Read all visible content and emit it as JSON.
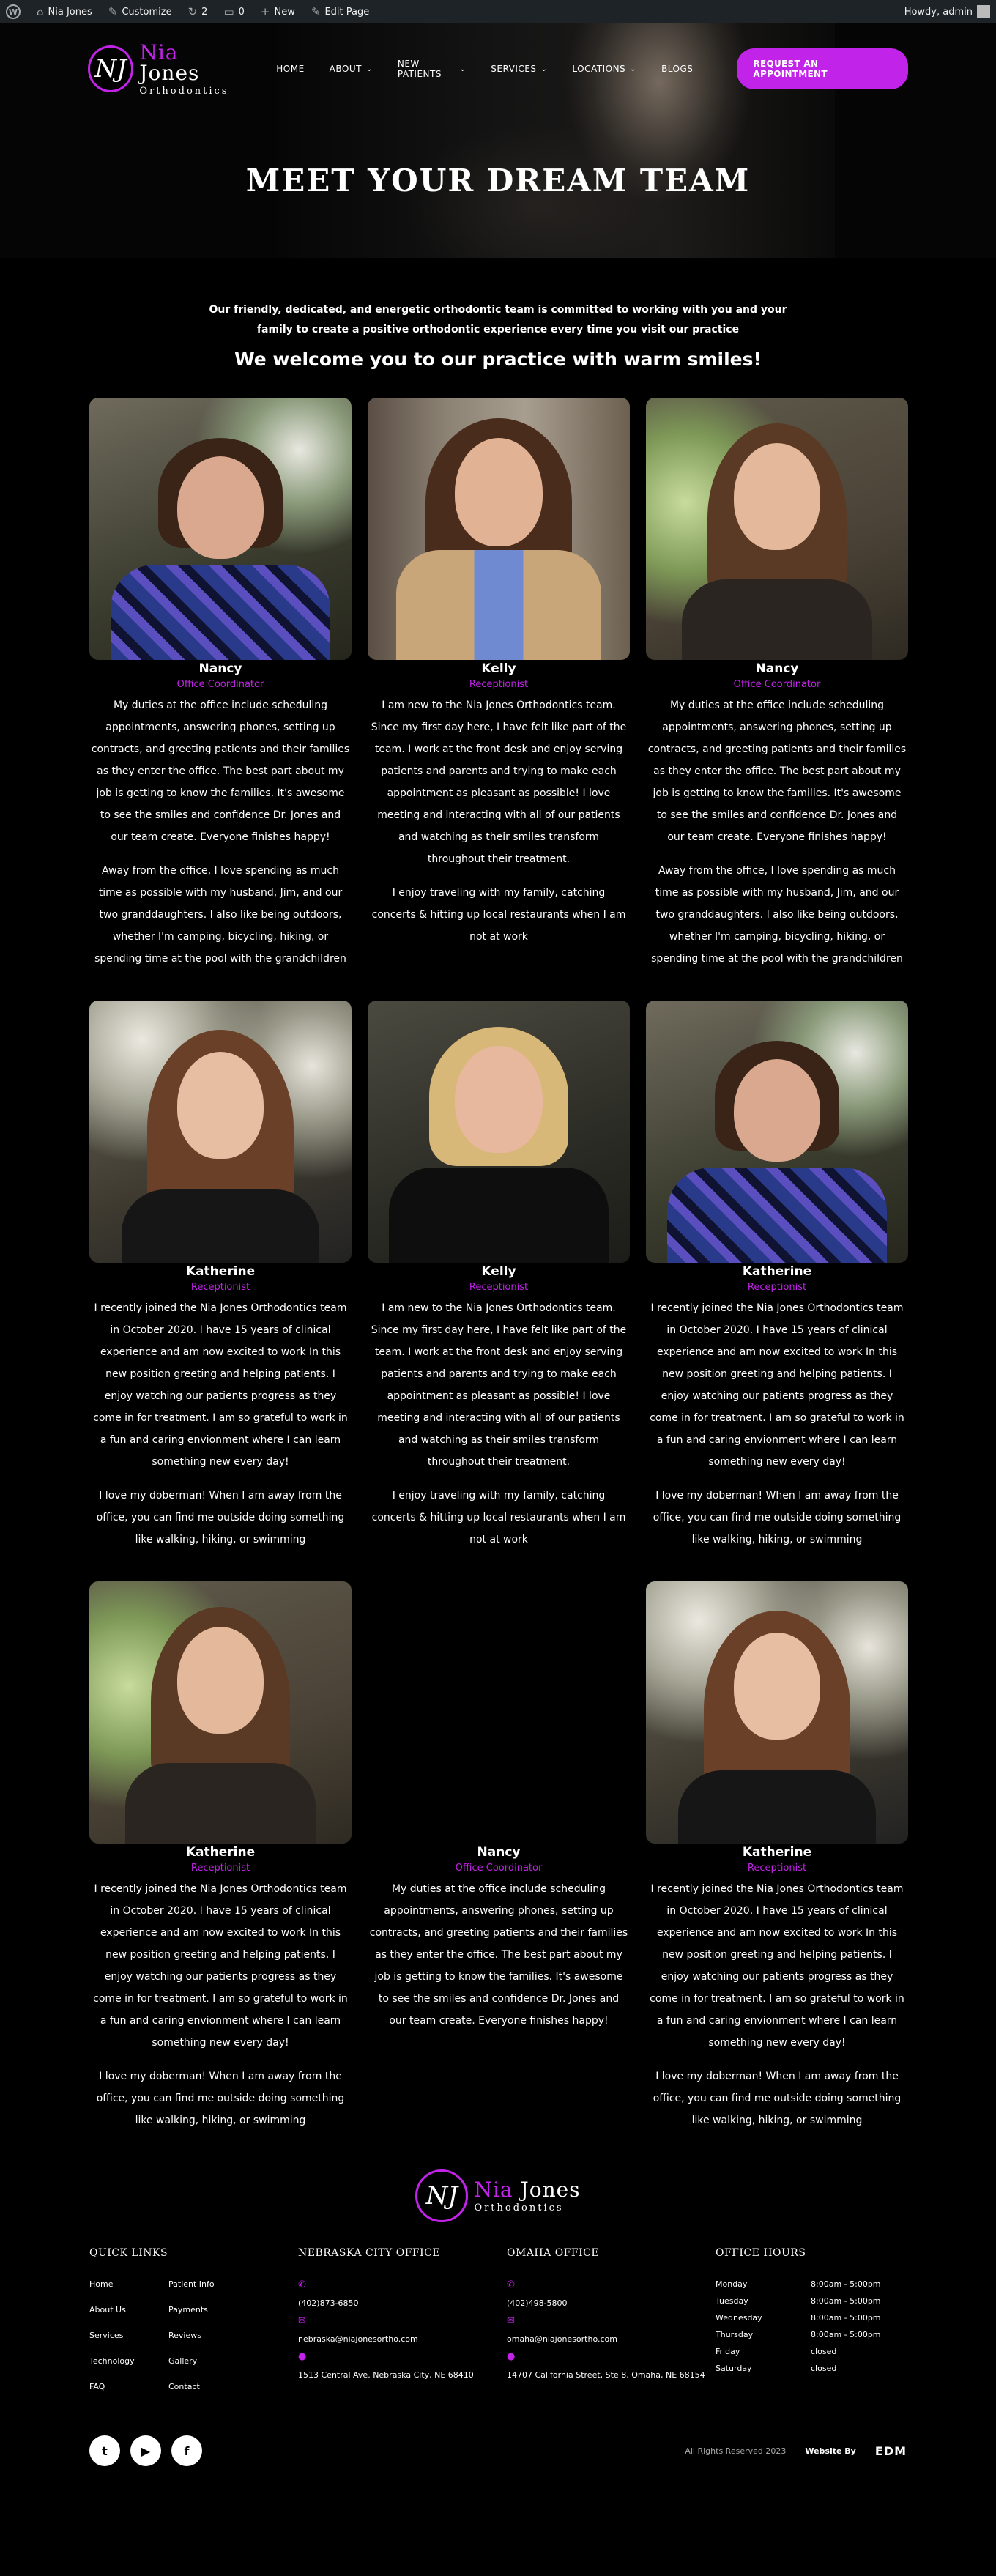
{
  "admin_bar": {
    "site": "Nia Jones",
    "customize": "Customize",
    "updates": "2",
    "comments": "0",
    "new": "New",
    "edit": "Edit Page",
    "howdy": "Howdy, admin"
  },
  "brand": {
    "first": "Nia",
    "last": "Jones",
    "sub": "Orthodontics",
    "mark": "NJ",
    "accent": "#c223e8"
  },
  "nav": {
    "items": [
      "HOME",
      "ABOUT",
      "NEW PATIENTS",
      "SERVICES",
      "LOCATIONS",
      "BLOGS"
    ],
    "cta": "REQUEST AN APPOINTMENT"
  },
  "hero": {
    "title": "MEET YOUR DREAM TEAM"
  },
  "intro": {
    "text": "Our friendly, dedicated, and energetic orthodontic team is committed to working with you and your family to create a positive orthodontic experience every time you visit our practice",
    "welcome": "We welcome you to our practice with warm smiles!"
  },
  "team": [
    {
      "name": "Nancy",
      "role": "Office Coordinator",
      "bio1": "My duties at the office include scheduling appointments, answering phones, setting up contracts, and greeting patients and their families as they enter the office. The best part about my job is getting to know the families. It's awesome to see the smiles and confidence Dr. Jones and our team create. Everyone finishes happy!",
      "bio2": "Away from the office, I love spending as much time as possible with my husband, Jim, and our two granddaughters. I also like being outdoors, whether I'm camping, bicycling, hiking, or spending time at the pool with the grandchildren"
    },
    {
      "name": "Kelly",
      "role": "Receptionist",
      "bio1": "I am new to the Nia Jones Orthodontics team. Since my first day here, I have felt like part of the team. I work at the front desk and enjoy serving patients and parents and trying to make each appointment as pleasant as possible! I love meeting and interacting with all of our patients and watching as their smiles transform throughout their treatment.",
      "bio2": "I enjoy traveling with my family, catching concerts & hitting up local restaurants when I am not at work"
    },
    {
      "name": "Nancy",
      "role": "Office Coordinator",
      "bio1": "My duties at the office include scheduling appointments, answering phones, setting up contracts, and greeting patients and their families as they enter the office. The best part about my job is getting to know the families. It's awesome to see the smiles and confidence Dr. Jones and our team create. Everyone finishes happy!",
      "bio2": "Away from the office, I love spending as much time as possible with my husband, Jim, and our two granddaughters. I also like being outdoors, whether I'm camping, bicycling, hiking, or spending time at the pool with the grandchildren"
    },
    {
      "name": "Katherine",
      "role": "Receptionist",
      "bio1": "I recently joined the Nia Jones Orthodontics team in October 2020. I have 15 years of clinical experience and am now excited to work In this new position greeting and helping patients. I enjoy watching our patients progress as they come in for treatment. I am so grateful to work in a fun and caring envionment where I can learn something new every day!",
      "bio2": "I love my doberman! When I am away from the office, you can find me outside doing something like walking, hiking, or swimming"
    },
    {
      "name": "Kelly",
      "role": "Receptionist",
      "bio1": "I am new to the Nia Jones Orthodontics team. Since my first day here, I have felt like part of the team. I work at the front desk and enjoy serving patients and parents and trying to make each appointment as pleasant as possible! I love meeting and interacting with all of our patients and watching as their smiles transform throughout their treatment.",
      "bio2": "I enjoy traveling with my family, catching concerts & hitting up local restaurants when I am not at work"
    },
    {
      "name": "Katherine",
      "role": "Receptionist",
      "bio1": "I recently joined the Nia Jones Orthodontics team in October 2020. I have 15 years of clinical experience and am now excited to work In this new position greeting and helping patients. I enjoy watching our patients progress as they come in for treatment. I am so grateful to work in a fun and caring envionment where I can learn something new every day!",
      "bio2": "I love my doberman! When I am away from the office, you can find me outside doing something like walking, hiking, or swimming"
    },
    {
      "name": "Katherine",
      "role": "Receptionist",
      "bio1": "I recently joined the Nia Jones Orthodontics team in October 2020. I have 15 years of clinical experience and am now excited to work In this new position greeting and helping patients. I enjoy watching our patients progress as they come in for treatment. I am so grateful to work in a fun and caring envionment where I can learn something new every day!",
      "bio2": "I love my doberman! When I am away from the office, you can find me outside doing something like walking, hiking, or swimming"
    },
    {
      "name": "Nancy",
      "role": "Office Coordinator",
      "bio1": "My duties at the office include scheduling appointments, answering phones, setting up contracts, and greeting patients and their families as they enter the office. The best part about my job is getting to know the families. It's awesome to see the smiles and confidence Dr. Jones and our team create. Everyone finishes happy!",
      "bio2": ""
    },
    {
      "name": "Katherine",
      "role": "Receptionist",
      "bio1": "I recently joined the Nia Jones Orthodontics team in October 2020. I have 15 years of clinical experience and am now excited to work In this new position greeting and helping patients. I enjoy watching our patients progress as they come in for treatment. I am so grateful to work in a fun and caring envionment where I can learn something new every day!",
      "bio2": "I love my doberman! When I am away from the office, you can find me outside doing something like walking, hiking, or swimming"
    }
  ],
  "footer": {
    "quick_links_title": "QUICK LINKS",
    "links": [
      "Home",
      "Patient Info",
      "About Us",
      "Payments",
      "Services",
      "Reviews",
      "Technology",
      "Gallery",
      "FAQ",
      "Contact"
    ],
    "nebraska": {
      "title": "NEBRASKA CITY OFFICE",
      "phone": "(402)873-6850",
      "email": "nebraska@niajonesortho.com",
      "address": "1513 Central Ave. Nebraska City, NE 68410"
    },
    "omaha": {
      "title": "OMAHA OFFICE",
      "phone": "(402)498-5800",
      "email": "omaha@niajonesortho.com",
      "address": "14707 California Street, Ste 8, Omaha, NE 68154"
    },
    "hours_title": "OFFICE HOURS",
    "hours": [
      {
        "day": "Monday",
        "time": "8:00am - 5:00pm"
      },
      {
        "day": "Tuesday",
        "time": "8:00am - 5:00pm"
      },
      {
        "day": "Wednesday",
        "time": "8:00am - 5:00pm"
      },
      {
        "day": "Thursday",
        "time": "8:00am - 5:00pm"
      },
      {
        "day": "Friday",
        "time": "closed"
      },
      {
        "day": "Saturday",
        "time": "closed"
      }
    ],
    "copyright": "All Rights Reserved 2023",
    "website_by": "Website By",
    "agency": "EDM"
  }
}
